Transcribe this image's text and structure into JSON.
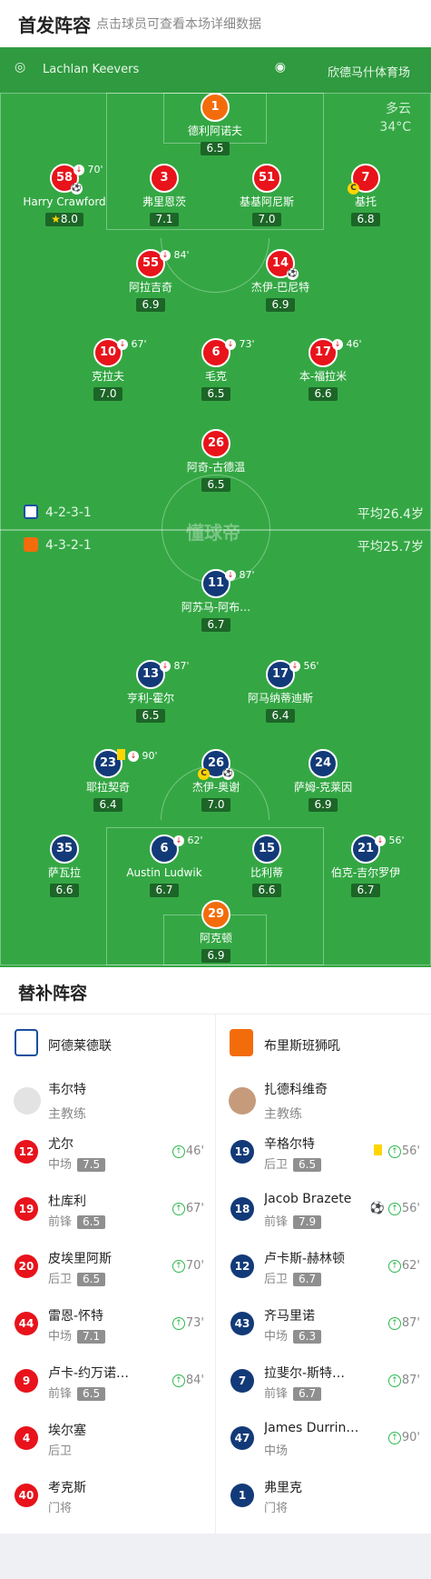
{
  "header": {
    "title": "首发阵容",
    "subtitle": "点击球员可查看本场详细数据"
  },
  "match": {
    "referee": "Lachlan Keevers",
    "venue": "欣德马什体育场",
    "weather": "多云",
    "temperature": "34°C",
    "watermark": "懂球帝"
  },
  "home": {
    "formation": "4-2-3-1",
    "avg_age": "平均26.4岁",
    "team": "阿德莱德联",
    "coach": "韦尔特",
    "coach_role": "主教练",
    "players": [
      {
        "num": "1",
        "name": "德利阿诺夫",
        "rating": "6.5",
        "color": "ora"
      },
      {
        "num": "58",
        "name": "Harry Crawford",
        "rating": "8.0",
        "color": "red",
        "minute": "70'",
        "sub": true,
        "goal": true,
        "star": true
      },
      {
        "num": "3",
        "name": "弗里恩茨",
        "rating": "7.1",
        "color": "red"
      },
      {
        "num": "51",
        "name": "基基阿尼斯",
        "rating": "7.0",
        "color": "red"
      },
      {
        "num": "7",
        "name": "基托",
        "rating": "6.8",
        "color": "red",
        "captain": true
      },
      {
        "num": "55",
        "name": "阿拉吉奇",
        "rating": "6.9",
        "color": "red",
        "minute": "84'",
        "sub": true
      },
      {
        "num": "14",
        "name": "杰伊-巴尼特",
        "rating": "6.9",
        "color": "red",
        "ball": true
      },
      {
        "num": "10",
        "name": "克拉夫",
        "rating": "7.0",
        "color": "red",
        "minute": "67'",
        "sub": true
      },
      {
        "num": "6",
        "name": "毛克",
        "rating": "6.5",
        "color": "red",
        "minute": "73'",
        "sub": true
      },
      {
        "num": "17",
        "name": "本-福拉米",
        "rating": "6.6",
        "color": "red",
        "minute": "46'",
        "sub": true
      },
      {
        "num": "26",
        "name": "阿奇-古德温",
        "rating": "6.5",
        "color": "red"
      }
    ]
  },
  "away": {
    "formation": "4-3-2-1",
    "avg_age": "平均25.7岁",
    "team": "布里斯班狮吼",
    "coach": "扎德科维奇",
    "coach_role": "主教练",
    "players": [
      {
        "num": "11",
        "name": "阿苏马-阿布…",
        "rating": "6.7",
        "color": "blu",
        "minute": "87'",
        "sub": true
      },
      {
        "num": "13",
        "name": "亨利-霍尔",
        "rating": "6.5",
        "color": "blu",
        "minute": "87'",
        "sub": true
      },
      {
        "num": "17",
        "name": "阿马纳蒂迪斯",
        "rating": "6.4",
        "color": "blu",
        "minute": "56'",
        "sub": true
      },
      {
        "num": "23",
        "name": "耶拉契奇",
        "rating": "6.4",
        "color": "blu",
        "minute": "90'",
        "sub": true,
        "yellow": true
      },
      {
        "num": "26",
        "name": "杰伊-奥谢",
        "rating": "7.0",
        "color": "blu",
        "captain": true,
        "ball": true
      },
      {
        "num": "24",
        "name": "萨姆-克莱因",
        "rating": "6.9",
        "color": "blu"
      },
      {
        "num": "35",
        "name": "萨瓦拉",
        "rating": "6.6",
        "color": "blu"
      },
      {
        "num": "6",
        "name": "Austin Ludwik",
        "rating": "6.7",
        "color": "blu",
        "minute": "62'",
        "sub": true
      },
      {
        "num": "15",
        "name": "比利蒂",
        "rating": "6.6",
        "color": "blu"
      },
      {
        "num": "21",
        "name": "伯克-吉尔罗伊",
        "rating": "6.7",
        "color": "blu",
        "minute": "56'",
        "sub": true
      },
      {
        "num": "29",
        "name": "阿克顿",
        "rating": "6.9",
        "color": "ora"
      }
    ]
  },
  "subs": {
    "title": "替补阵容",
    "home": [
      {
        "num": "12",
        "name": "尤尔",
        "pos": "中场",
        "rating": "7.5",
        "minute": "46'"
      },
      {
        "num": "19",
        "name": "杜库利",
        "pos": "前锋",
        "rating": "6.5",
        "minute": "67'"
      },
      {
        "num": "20",
        "name": "皮埃里阿斯",
        "pos": "后卫",
        "rating": "6.5",
        "minute": "70'"
      },
      {
        "num": "44",
        "name": "雷恩-怀特",
        "pos": "中场",
        "rating": "7.1",
        "minute": "73'"
      },
      {
        "num": "9",
        "name": "卢卡-约万诺…",
        "pos": "前锋",
        "rating": "6.5",
        "minute": "84'"
      },
      {
        "num": "4",
        "name": "埃尔塞",
        "pos": "后卫",
        "rating": "",
        "minute": ""
      },
      {
        "num": "40",
        "name": "考克斯",
        "pos": "门将",
        "rating": "",
        "minute": ""
      }
    ],
    "away": [
      {
        "num": "19",
        "name": "辛格尔特",
        "pos": "后卫",
        "rating": "6.5",
        "minute": "56'",
        "yellow": true
      },
      {
        "num": "18",
        "name": "Jacob Brazete",
        "pos": "前锋",
        "rating": "7.9",
        "minute": "56'",
        "goal": true
      },
      {
        "num": "12",
        "name": "卢卡斯-赫林顿",
        "pos": "后卫",
        "rating": "6.7",
        "minute": "62'"
      },
      {
        "num": "43",
        "name": "齐马里诺",
        "pos": "中场",
        "rating": "6.3",
        "minute": "87'"
      },
      {
        "num": "7",
        "name": "拉斐尔-斯特…",
        "pos": "前锋",
        "rating": "6.7",
        "minute": "87'"
      },
      {
        "num": "47",
        "name": "James Durrin…",
        "pos": "中场",
        "rating": "",
        "minute": "90'"
      },
      {
        "num": "1",
        "name": "弗里克",
        "pos": "门将",
        "rating": "",
        "minute": ""
      }
    ]
  },
  "colors": {
    "pitch": "#34a744",
    "home": "#e8131b",
    "away": "#133a78",
    "keeper": "#f36c0c"
  }
}
